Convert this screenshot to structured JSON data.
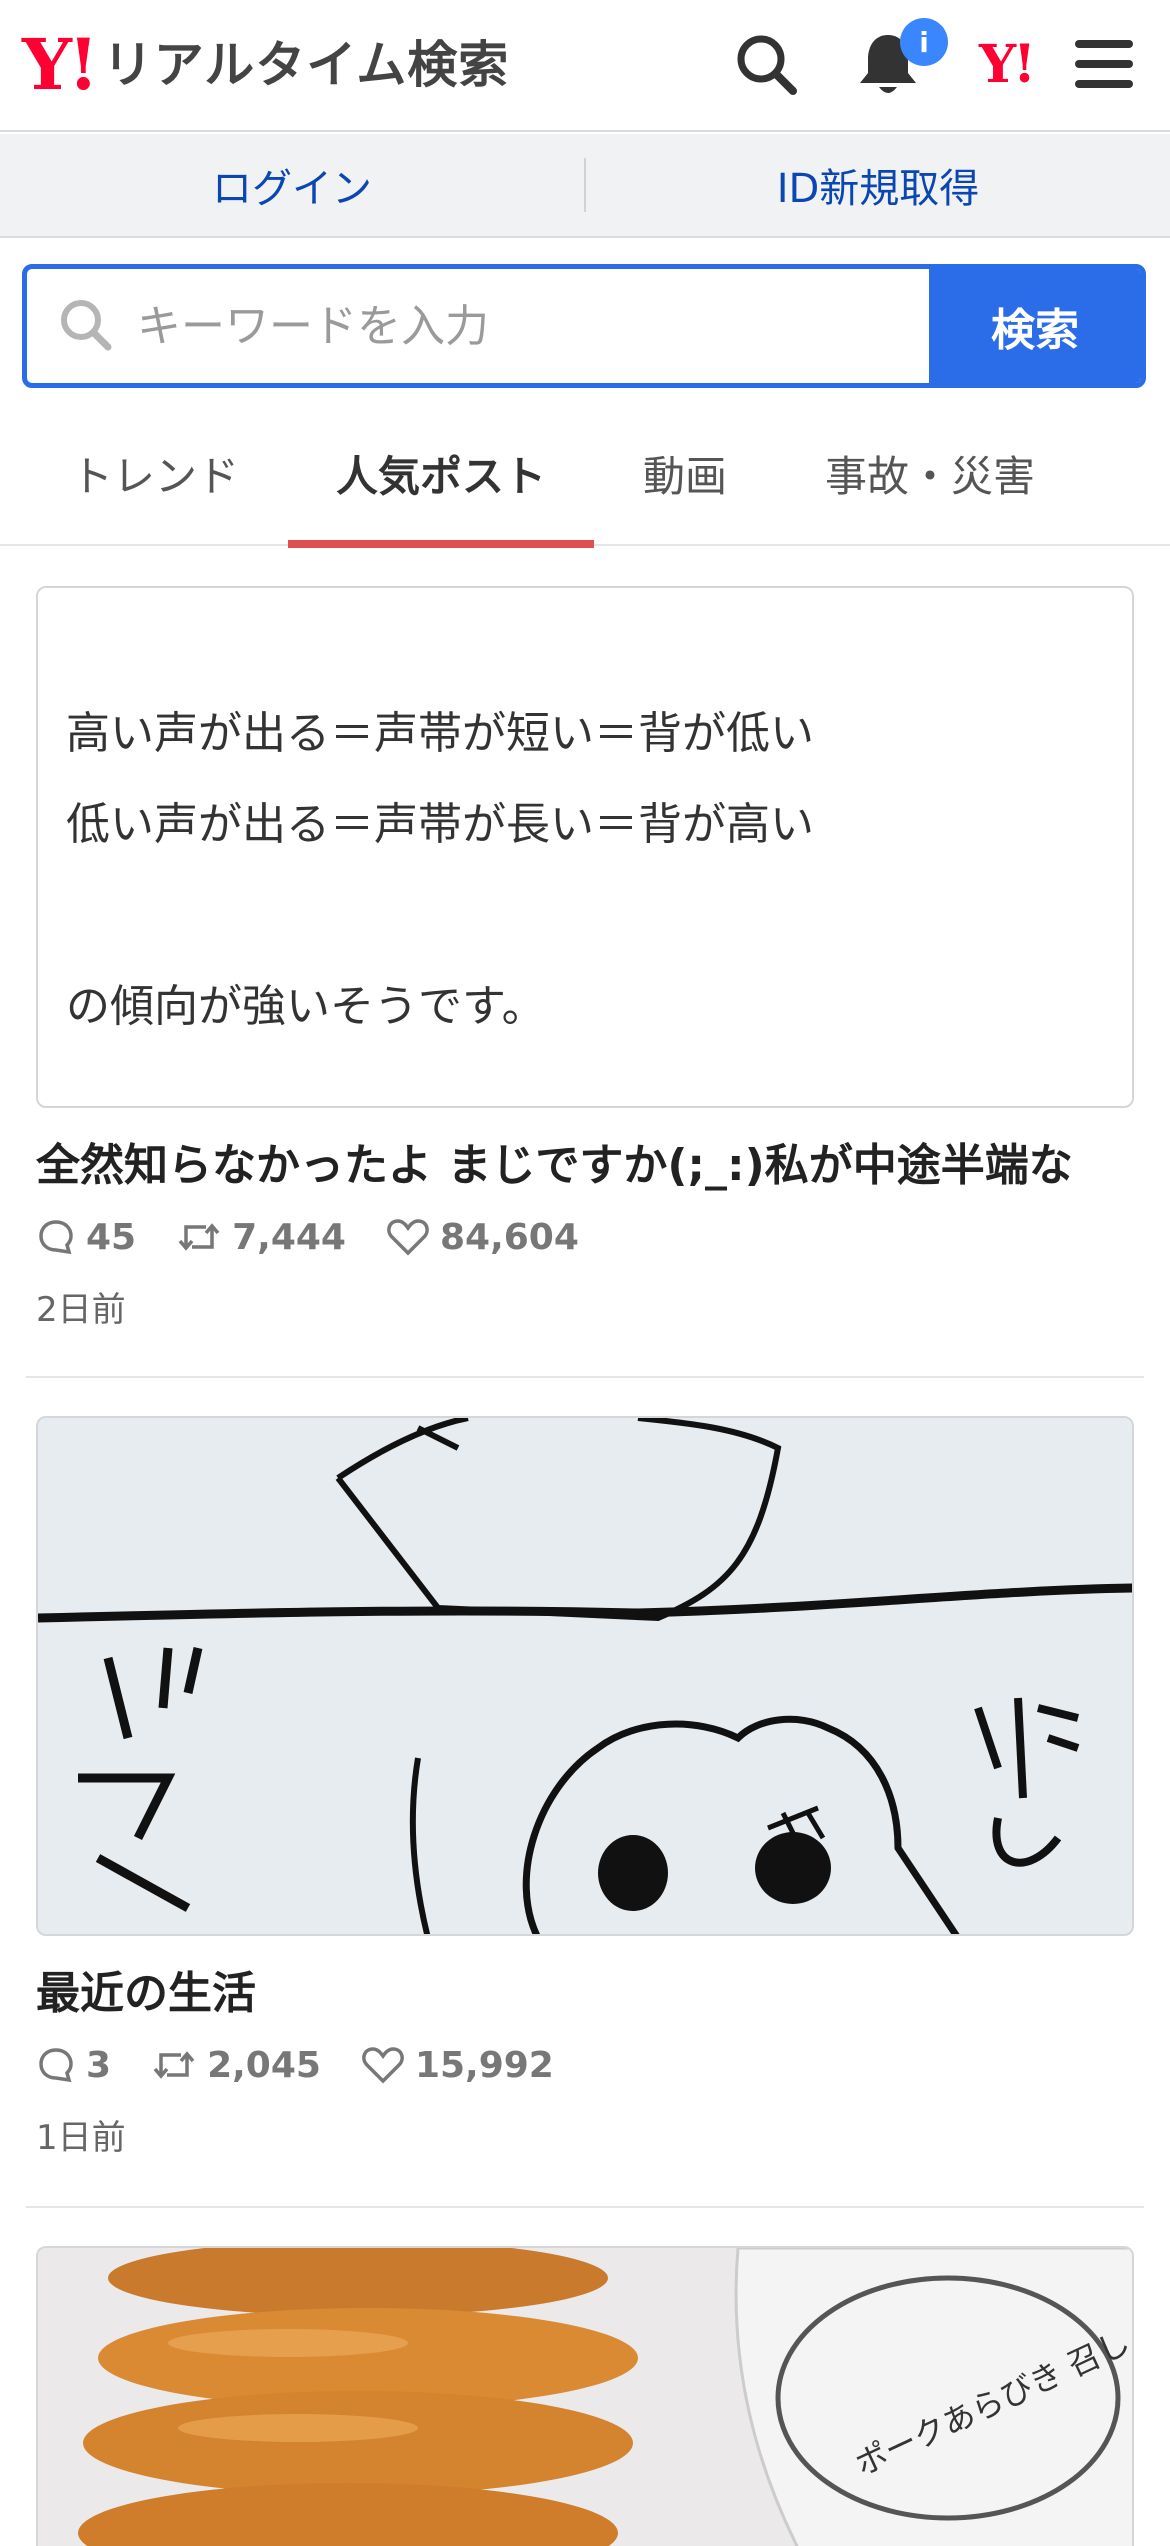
{
  "header": {
    "logo_mark": "Y!",
    "logo_text": "リアルタイム検索",
    "notification_badge": "i",
    "yahoo_mark": "Y!"
  },
  "account": {
    "login_label": "ログイン",
    "register_label": "ID新規取得"
  },
  "search": {
    "placeholder": "キーワードを入力",
    "value": "",
    "button_label": "検索"
  },
  "tabs": [
    {
      "label": "トレンド",
      "active": false
    },
    {
      "label": "人気ポスト",
      "active": true
    },
    {
      "label": "動画",
      "active": false
    },
    {
      "label": "事故・災害",
      "active": false
    }
  ],
  "posts": [
    {
      "card_text": "高い声が出る＝声帯が短い＝背が低い\n低い声が出る＝声帯が長い＝背が高い\n\nの傾向が強いそうです。",
      "title": "全然知らなかったよ まじですか(;_:)私が中途半端な",
      "replies": "45",
      "reposts": "7,444",
      "likes": "84,604",
      "time": "2日前"
    },
    {
      "image_text_1": "ブス",
      "image_text_2": "推し",
      "title": "最近の生活",
      "replies": "3",
      "reposts": "2,045",
      "likes": "15,992",
      "time": "1日前"
    },
    {
      "image_text": "ポークあらびき 召し上がり"
    }
  ],
  "colors": {
    "brand_red": "#ff0033",
    "accent_blue": "#2b6de8",
    "tab_underline": "#e0504e",
    "link_blue": "#0b47b3"
  }
}
